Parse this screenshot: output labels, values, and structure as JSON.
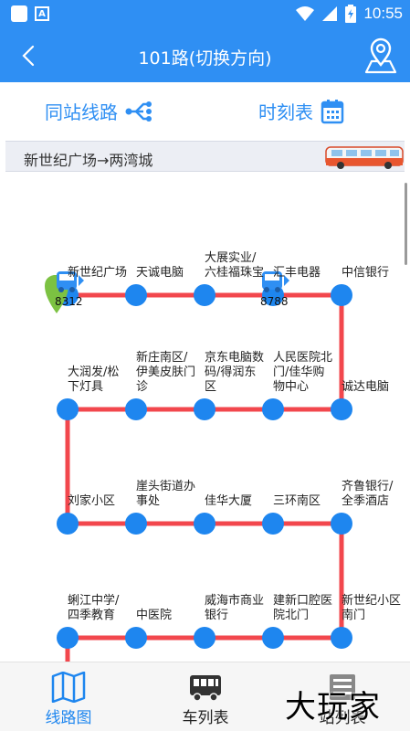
{
  "status_bar": {
    "time": "10:55",
    "notification_badge": "A"
  },
  "header": {
    "title": "101路(切换方向)"
  },
  "toolbar": {
    "same_station": "同站线路",
    "timetable": "时刻表"
  },
  "direction": {
    "text": "新世纪广场→两湾城"
  },
  "route_color": "#f2474d",
  "stop_color": "#1e86ef",
  "brand_color": "#2f8ff3",
  "stations": [
    {
      "name": "新世纪广场"
    },
    {
      "name": "天诚电脑"
    },
    {
      "name": "大展实业/\n六桂福珠宝"
    },
    {
      "name": "汇丰电器"
    },
    {
      "name": "中信银行"
    },
    {
      "name": "诚达电脑"
    },
    {
      "name": "人民医院北\n门/佳华购\n物中心"
    },
    {
      "name": "京东电脑数\n码/得润东\n区"
    },
    {
      "name": "新庄南区/\n伊美皮肤门\n诊"
    },
    {
      "name": "大润发/松\n下灯具"
    },
    {
      "name": "刘家小区"
    },
    {
      "name": "崖头街道办\n事处"
    },
    {
      "name": "佳华大厦"
    },
    {
      "name": "三环南区"
    },
    {
      "name": "齐鲁银行/\n全季酒店"
    },
    {
      "name": "新世纪小区\n南门"
    },
    {
      "name": "建新口腔医\n院北门"
    },
    {
      "name": "威海市商业\n银行"
    },
    {
      "name": "中医院"
    },
    {
      "name": "蜊江中学/\n四季教育"
    }
  ],
  "buses": [
    {
      "number": "8312",
      "at_station": "新世纪广场"
    },
    {
      "number": "8788",
      "at_station": "汇丰电器"
    }
  ],
  "tabs": [
    {
      "label": "线路图",
      "icon": "map-icon",
      "active": true
    },
    {
      "label": "车列表",
      "icon": "bus-icon",
      "active": false
    },
    {
      "label": "站列表",
      "icon": "list-icon",
      "active": false
    }
  ],
  "watermark": "大玩家"
}
